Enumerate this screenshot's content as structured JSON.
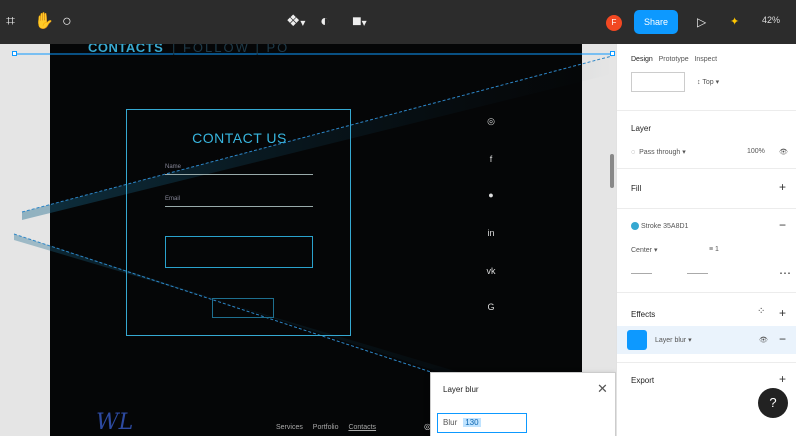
{
  "toolbar": {
    "icons": [
      "frame-icon",
      "hand-icon",
      "comment-icon",
      "component-icon",
      "contrast-icon",
      "share-icon"
    ],
    "avatar_initial": "F",
    "share_label": "Share",
    "play_label": "▷",
    "zoom": "42%"
  },
  "canvas": {
    "frame_title": "CONTACTS",
    "frame_title_ghost": "| FOLLOW | PO",
    "contact_title": "CONTACT US",
    "field1_label": "Name",
    "field2_label": "Email",
    "footer_links": [
      "Services",
      "Portfolio",
      "Contacts"
    ],
    "logo": "WL",
    "social_icons": [
      "instagram-icon",
      "facebook-icon",
      "dribbble-icon",
      "linkedin-icon",
      "vk-icon",
      "google-icon"
    ]
  },
  "layer_popup": {
    "title": "Layer blur",
    "close": "✕",
    "input_prefix": "Blur",
    "input_value": "130"
  },
  "panel": {
    "tabs": [
      "Design",
      "Prototype",
      "Inspect"
    ],
    "constraint_value": "Top",
    "layer_head": "Layer",
    "blend_mode": "Pass through",
    "opacity": "100%",
    "fill_head": "Fill",
    "stroke_head": "Stroke",
    "stroke_color": "35A8D1",
    "stroke_pos": "Center",
    "stroke_width": "1",
    "effects_head": "Effects",
    "effect_name": "Layer blur",
    "export_head": "Export",
    "help": "?"
  },
  "colors": {
    "accent": "#0d99ff",
    "frame_bg": "#050607",
    "cyan": "#35a8d1"
  }
}
